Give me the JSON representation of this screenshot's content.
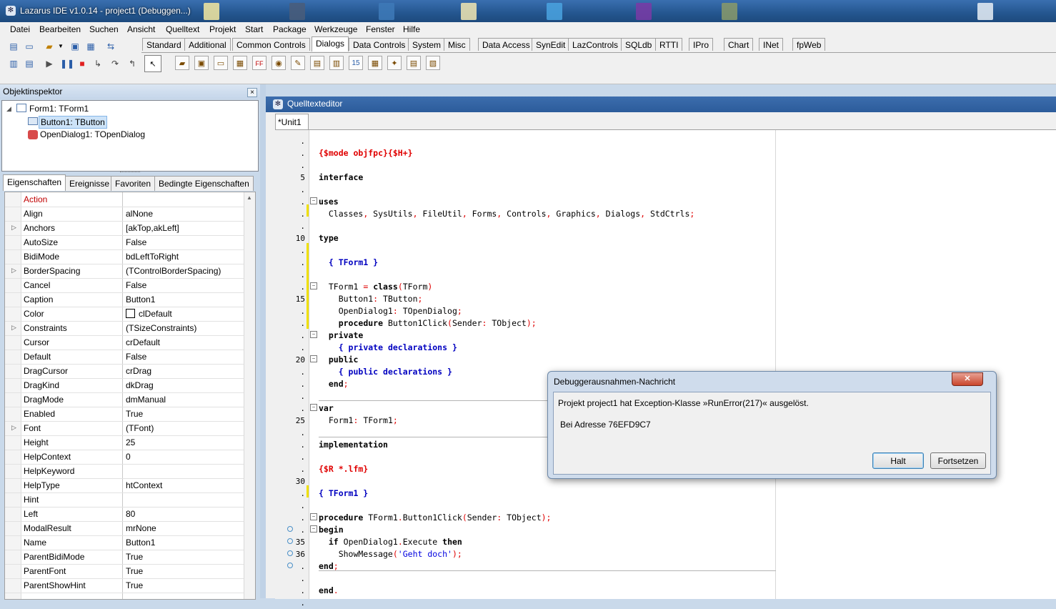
{
  "window": {
    "title": "Lazarus IDE v1.0.14 - project1 (Debuggen...)"
  },
  "menu": [
    "Datei",
    "Bearbeiten",
    "Suchen",
    "Ansicht",
    "Quelltext",
    "Projekt",
    "Start",
    "Package",
    "Werkzeuge",
    "Fenster",
    "Hilfe"
  ],
  "palette_tabs": [
    "Standard",
    "Additional",
    "Common Controls",
    "Dialogs",
    "Data Controls",
    "System",
    "Misc",
    "Data Access",
    "SynEdit",
    "LazControls",
    "SQLdb",
    "RTTI",
    "IPro",
    "Chart",
    "INet",
    "fpWeb"
  ],
  "palette_selected": "Dialogs",
  "object_inspector": {
    "title": "Objektinspektor",
    "tree": [
      {
        "label": "Form1: TForm1"
      },
      {
        "label": "Button1: TButton"
      },
      {
        "label": "OpenDialog1: TOpenDialog"
      }
    ],
    "tabs": [
      "Eigenschaften",
      "Ereignisse",
      "Favoriten",
      "Bedingte Eigenschaften"
    ],
    "properties": [
      {
        "name": "Action",
        "value": ""
      },
      {
        "name": "Align",
        "value": "alNone"
      },
      {
        "name": "Anchors",
        "value": "[akTop,akLeft]",
        "expandable": true
      },
      {
        "name": "AutoSize",
        "value": "False"
      },
      {
        "name": "BidiMode",
        "value": "bdLeftToRight"
      },
      {
        "name": "BorderSpacing",
        "value": "(TControlBorderSpacing)",
        "expandable": true
      },
      {
        "name": "Cancel",
        "value": "False"
      },
      {
        "name": "Caption",
        "value": "Button1"
      },
      {
        "name": "Color",
        "value": "clDefault"
      },
      {
        "name": "Constraints",
        "value": "(TSizeConstraints)",
        "expandable": true
      },
      {
        "name": "Cursor",
        "value": "crDefault"
      },
      {
        "name": "Default",
        "value": "False"
      },
      {
        "name": "DragCursor",
        "value": "crDrag"
      },
      {
        "name": "DragKind",
        "value": "dkDrag"
      },
      {
        "name": "DragMode",
        "value": "dmManual"
      },
      {
        "name": "Enabled",
        "value": "True"
      },
      {
        "name": "Font",
        "value": "(TFont)",
        "expandable": true
      },
      {
        "name": "Height",
        "value": "25"
      },
      {
        "name": "HelpContext",
        "value": "0"
      },
      {
        "name": "HelpKeyword",
        "value": ""
      },
      {
        "name": "HelpType",
        "value": "htContext"
      },
      {
        "name": "Hint",
        "value": ""
      },
      {
        "name": "Left",
        "value": "80"
      },
      {
        "name": "ModalResult",
        "value": "mrNone"
      },
      {
        "name": "Name",
        "value": "Button1"
      },
      {
        "name": "ParentBidiMode",
        "value": "True"
      },
      {
        "name": "ParentFont",
        "value": "True"
      },
      {
        "name": "ParentShowHint",
        "value": "True"
      }
    ]
  },
  "editor": {
    "title": "Quelltexteditor",
    "tab": "*Unit1",
    "line_numbers": [
      "5",
      "10",
      "15",
      "20",
      "25",
      "30",
      "35",
      "36"
    ]
  },
  "dialog": {
    "title": "Debuggerausnahmen-Nachricht",
    "message": "Projekt project1 hat Exception-Klasse »RunError(217)« ausgelöst.",
    "address": "Bei Adresse 76EFD9C7",
    "btn_halt": "Halt",
    "btn_continue": "Fortsetzen"
  }
}
